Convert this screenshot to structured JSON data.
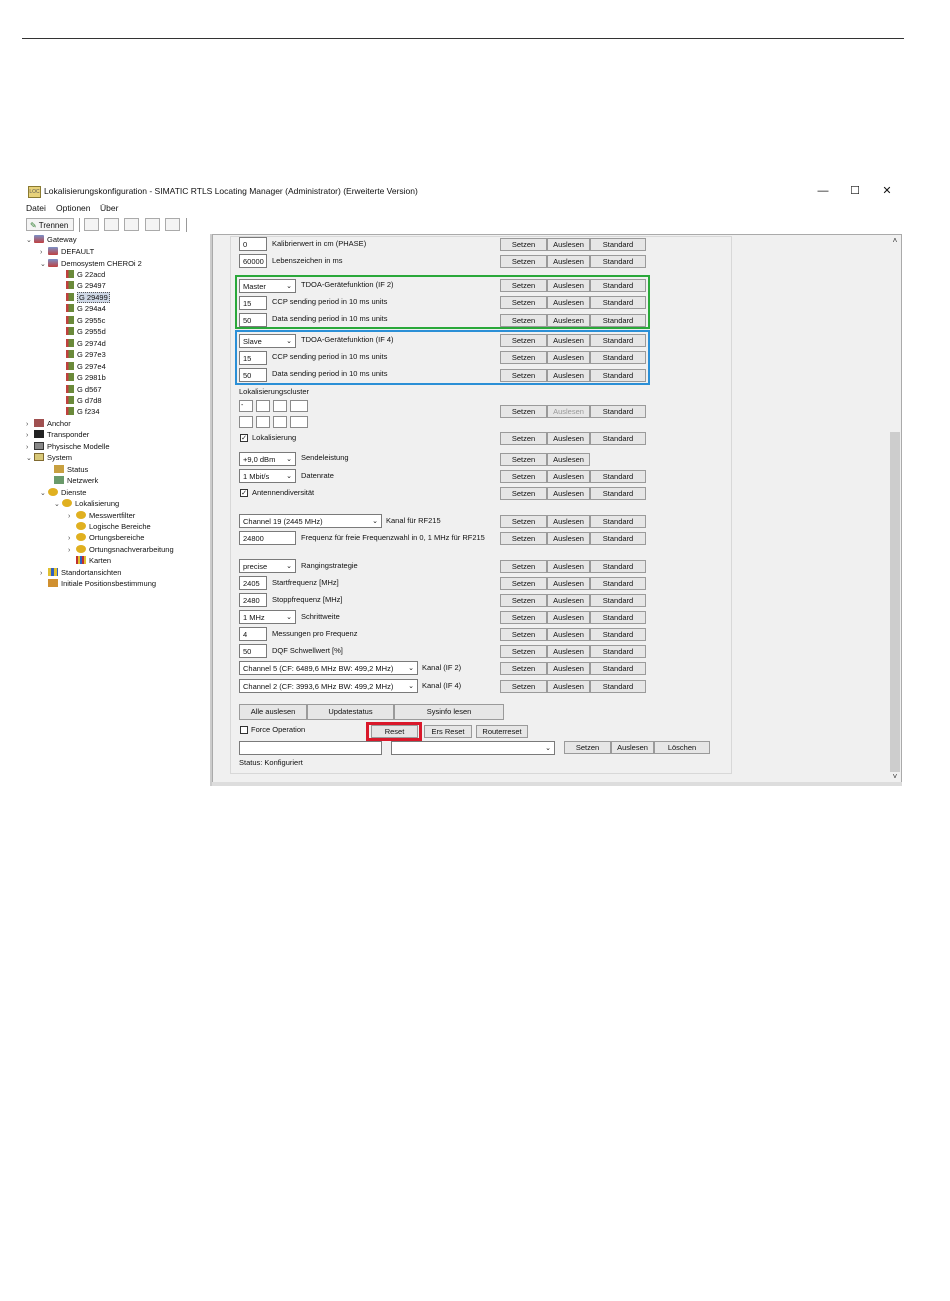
{
  "window": {
    "title": "Lokalisierungskonfiguration - SIMATIC RTLS Locating Manager  (Administrator)  (Erweiterte Version)",
    "app_icon": "LOC",
    "minimize": "—",
    "maximize": "☐",
    "close": "✕"
  },
  "menu": {
    "datei": "Datei",
    "optionen": "Optionen",
    "ueber": "Über"
  },
  "toolbar": {
    "trennen": "Trennen"
  },
  "tree": {
    "gateway": "Gateway",
    "default": "DEFAULT",
    "demosystem": "Demosystem CHEROi 2",
    "gateways": [
      "G 22acd",
      "G 29497",
      "G 29499",
      "G 294a4",
      "G 2955c",
      "G 2955d",
      "G 2974d",
      "G 297e3",
      "G 297e4",
      "G 2981b",
      "G d567",
      "G d7d8",
      "G f234"
    ],
    "anchor": "Anchor",
    "transponder": "Transponder",
    "physische_modelle": "Physische Modelle",
    "system": "System",
    "status": "Status",
    "netzwerk": "Netzwerk",
    "dienste": "Dienste",
    "lokalisierung": "Lokalisierung",
    "messwertfilter": "Messwertfilter",
    "logische_bereiche": "Logische Bereiche",
    "ortungsbereiche": "Ortungsbereiche",
    "ortungsnachverarbeitung": "Ortungsnachverarbeitung",
    "karten": "Karten",
    "standortansichten": "Standortansichten",
    "initiale": "Initiale Positionsbestimmung"
  },
  "buttons": {
    "setzen": "Setzen",
    "auslesen": "Auslesen",
    "standard": "Standard"
  },
  "rows": {
    "kalibrier": {
      "value": "0",
      "label": "Kalibrierwert in cm (PHASE)"
    },
    "lebenszeichen": {
      "value": "60000",
      "label": "Lebenszeichen in ms"
    },
    "tdoa2": {
      "value": "Master",
      "label": "TDOA-Gerätefunktion (IF 2)"
    },
    "ccp2": {
      "value": "15",
      "label": "CCP sending period in  10 ms units"
    },
    "data2": {
      "value": "50",
      "label": "Data sending period in  10 ms units"
    },
    "tdoa4": {
      "value": "Slave",
      "label": "TDOA-Gerätefunktion (IF 4)"
    },
    "ccp4": {
      "value": "15",
      "label": "CCP sending period in  10 ms units"
    },
    "data4": {
      "value": "50",
      "label": "Data sending period in  10 ms units"
    },
    "cluster": {
      "label": "Lokalisierungscluster",
      "first": "-"
    },
    "lokalisierung": {
      "label": "Lokalisierung",
      "checked": "✓"
    },
    "sendeleistung": {
      "value": "+9,0 dBm",
      "label": "Sendeleistung"
    },
    "datenrate": {
      "value": "1 Mbit/s",
      "label": "Datenrate"
    },
    "antennen": {
      "label": "Antennendiversität",
      "checked": "✓"
    },
    "kanal": {
      "value": "Channel 19 (2445 MHz)",
      "label": "Kanal für RF215"
    },
    "frequenz": {
      "value": "24800",
      "label": "Frequenz für freie Frequenzwahl in 0, 1 MHz für RF215"
    },
    "ranging": {
      "value": "precise",
      "label": "Rangingstrategie"
    },
    "start": {
      "value": "2405",
      "label": "Startfrequenz [MHz]"
    },
    "stopp": {
      "value": "2480",
      "label": "Stoppfrequenz [MHz]"
    },
    "schritt": {
      "value": "1 MHz",
      "label": "Schrittweite"
    },
    "messungen": {
      "value": "4",
      "label": "Messungen pro Frequenz"
    },
    "dqf": {
      "value": "50",
      "label": "DQF Schwellwert [%]"
    },
    "kanal2": {
      "value": "Channel 5 (CF: 6489,6 MHz BW: 499,2 MHz)",
      "label": "Kanal (IF 2)"
    },
    "kanal4": {
      "value": "Channel 2 (CF: 3993,6 MHz BW: 499,2 MHz)",
      "label": "Kanal (IF 4)"
    }
  },
  "bottom": {
    "alle_auslesen": "Alle auslesen",
    "updatestatus": "Updatestatus",
    "sysinfo": "Sysinfo lesen",
    "force": "Force Operation",
    "reset": "Reset",
    "ers_reset": "Ers Reset",
    "routerreset": "Routerreset",
    "setzen": "Setzen",
    "auslesen": "Auslesen",
    "loeschen": "Löschen",
    "status": "Status: Konfiguriert"
  },
  "colors": {
    "green_box": "#2aa83a",
    "blue_box": "#2b8fd6",
    "red_box": "#d9182a"
  }
}
